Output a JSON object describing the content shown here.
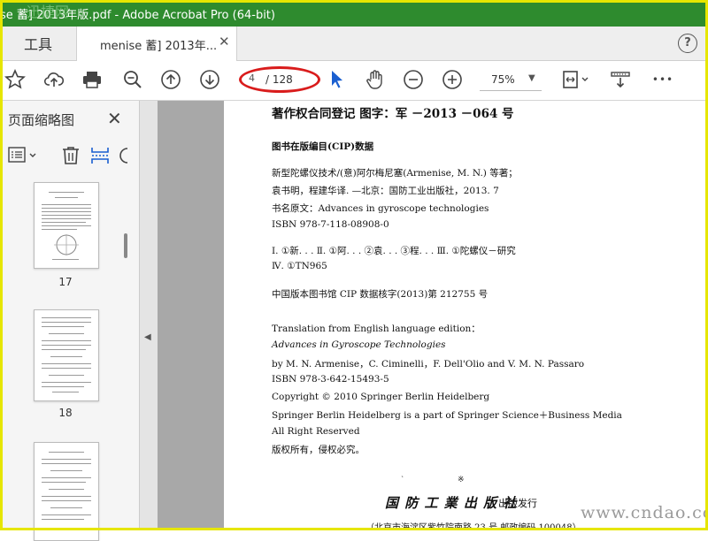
{
  "window": {
    "title": "se 蓄] 2013年版.pdf - Adobe Acrobat Pro (64-bit)",
    "watermark": "迅捷网"
  },
  "tabs": {
    "tools": "工具",
    "doc": "menise 蓄] 2013年...",
    "close": "✕",
    "help": "?"
  },
  "toolbar": {
    "page_number": "4",
    "page_total": "/ 128",
    "zoom": "75%",
    "zoom_arrow": "▼",
    "more": "•••"
  },
  "sidebar": {
    "title": "页面缩略图",
    "close": "✕",
    "thumbs": [
      {
        "label": "17"
      },
      {
        "label": "18"
      }
    ],
    "collapse_arrow": "◀"
  },
  "document": {
    "heading": "著作权合同登记   图字：军 －2013 －064 号",
    "cip_title": "图书在版编目(CIP)数据",
    "cip_lines": [
      "新型陀螺仪技术/(意)阿尔梅尼塞(Armenise, M. N.) 等著；",
      "袁书明，程建华译. —北京：国防工业出版社，2013. 7",
      "书名原文：Advances in gyroscope technologies",
      "ISBN 978-7-118-08908-0"
    ],
    "classification_1": "Ⅰ. ①新. . .    Ⅱ. ①阿. . . ②袁. . . ③程. . .    Ⅲ. ①陀螺仪－研究",
    "classification_2": "Ⅳ. ①TN965",
    "cip_number": "中国版本图书馆 CIP 数据核字(2013)第 212755 号",
    "translation_lines": [
      "Translation from English language edition：",
      "Advances in Gyroscope Technologies",
      "by M. N. Armenise，C. Ciminelli，F. Dell'Olio and V. M. N. Passaro",
      "ISBN 978-3-642-15493-5",
      "Copyright © 2010 Springer Berlin Heidelberg",
      "Springer Berlin Heidelberg is a part of Springer Science＋Business Media",
      "All Right Reserved",
      "版权所有，侵权必究。"
    ],
    "publisher_script": "国 防 工 業 出 版 社",
    "publisher_suffix": "出版发行",
    "address_fragment": "（北京市海淀区紫竹院南路 23 号  邮政编码 100048）"
  },
  "bottom_watermark": "www.cndao.com",
  "colors": {
    "titlebar": "#2e8b2e",
    "highlight": "#d91c1c",
    "pointer": "#1a5fd0"
  }
}
